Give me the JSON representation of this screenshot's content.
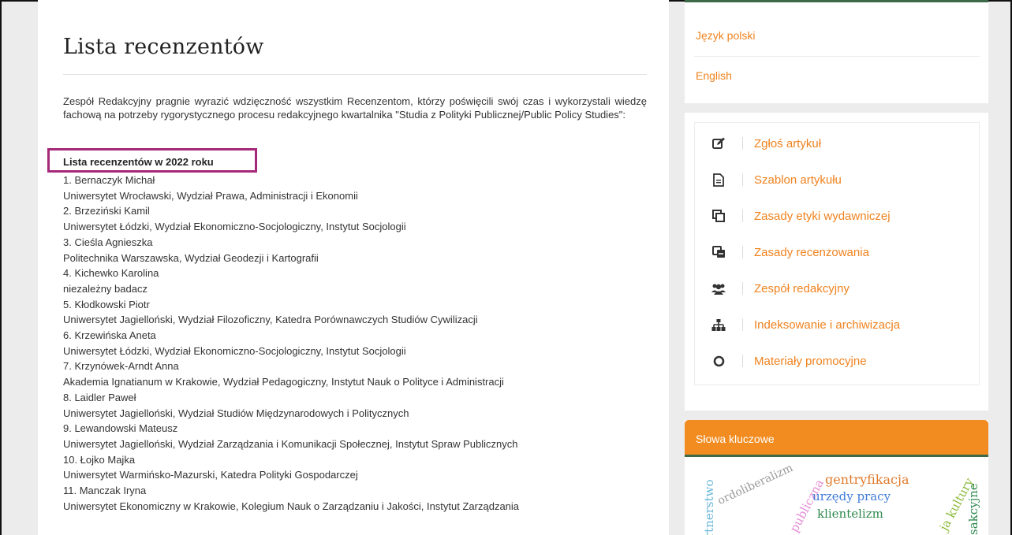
{
  "main": {
    "title": "Lista recenzentów",
    "intro": "Zespół Redakcyjny pragnie wyrazić wdzięczność wszystkim Recenzentom, którzy poświęcili swój czas i wykorzystali wiedzę fachową na potrzeby rygorystycznego procesu redakcyjnego kwartalnika \"Studia z Polityki Publicznej/Public Policy Studies\":",
    "year_heading": "Lista recenzentów w 2022 roku",
    "reviewers": [
      {
        "name": "1. Bernaczyk Michał",
        "affiliation": "Uniwersytet Wrocławski, Wydział Prawa, Administracji i Ekonomii"
      },
      {
        "name": "2. Brzeziński Kamil",
        "affiliation": "Uniwersytet Łódzki, Wydział Ekonomiczno-Socjologiczny, Instytut Socjologii"
      },
      {
        "name": "3. Cieśla Agnieszka",
        "affiliation": "Politechnika Warszawska, Wydział Geodezji i Kartografii"
      },
      {
        "name": "4. Kichewko Karolina",
        "affiliation": "niezależny badacz"
      },
      {
        "name": "5. Kłodkowski Piotr",
        "affiliation": "Uniwersytet Jagielloński, Wydział Filozoficzny, Katedra Porównawczych Studiów Cywilizacji"
      },
      {
        "name": "6. Krzewińska Aneta",
        "affiliation": "Uniwersytet Łódzki, Wydział Ekonomiczno-Socjologiczny, Instytut Socjologii"
      },
      {
        "name": "7. Krzynówek-Arndt Anna",
        "affiliation": "Akademia Ignatianum w Krakowie, Wydział Pedagogiczny, Instytut Nauk o Polityce i Administracji"
      },
      {
        "name": "8. Laidler Paweł",
        "affiliation": "Uniwersytet Jagielloński, Wydział Studiów Międzynarodowych i Politycznych"
      },
      {
        "name": "9. Lewandowski Mateusz",
        "affiliation": "Uniwersytet Jagielloński, Wydział Zarządzania i Komunikacji Społecznej, Instytut Spraw Publicznych"
      },
      {
        "name": "10. Łojko Majka",
        "affiliation": "Uniwersytet Warmińsko-Mazurski, Katedra Polityki Gospodarczej"
      },
      {
        "name": "11. Manczak Iryna",
        "affiliation": "Uniwersytet Ekonomiczny w Krakowie, Kolegium Nauk o Zarządzaniu i Jakości, Instytut Zarządzania"
      }
    ]
  },
  "sidebar": {
    "languages": [
      "Język polski",
      "English"
    ],
    "menu": [
      {
        "label": "Zgłoś artykuł",
        "icon": "edit-icon"
      },
      {
        "label": "Szablon artykułu",
        "icon": "file-text-icon"
      },
      {
        "label": "Zasady etyki wydawniczej",
        "icon": "copy-icon"
      },
      {
        "label": "Zasady recenzowania",
        "icon": "clone-icon"
      },
      {
        "label": "Zespół redakcyjny",
        "icon": "users-icon"
      },
      {
        "label": "Indeksowanie i archiwizacja",
        "icon": "sitemap-icon"
      },
      {
        "label": "Materiały promocyjne",
        "icon": "circle-icon"
      }
    ],
    "keywords_title": "Słowa kluczowe",
    "keywords": [
      "rtnerstwo",
      "ordoliberalizm",
      "a publiczna",
      "gentryfikacja",
      "urzędy pracy",
      "klientelizm",
      "ja kultury",
      "sakcyjne"
    ]
  },
  "colors": {
    "accent": "#f0821e",
    "header_orange": "#f28c20",
    "highlight_box": "#a5297a",
    "dark_green": "#3d6b4a"
  }
}
